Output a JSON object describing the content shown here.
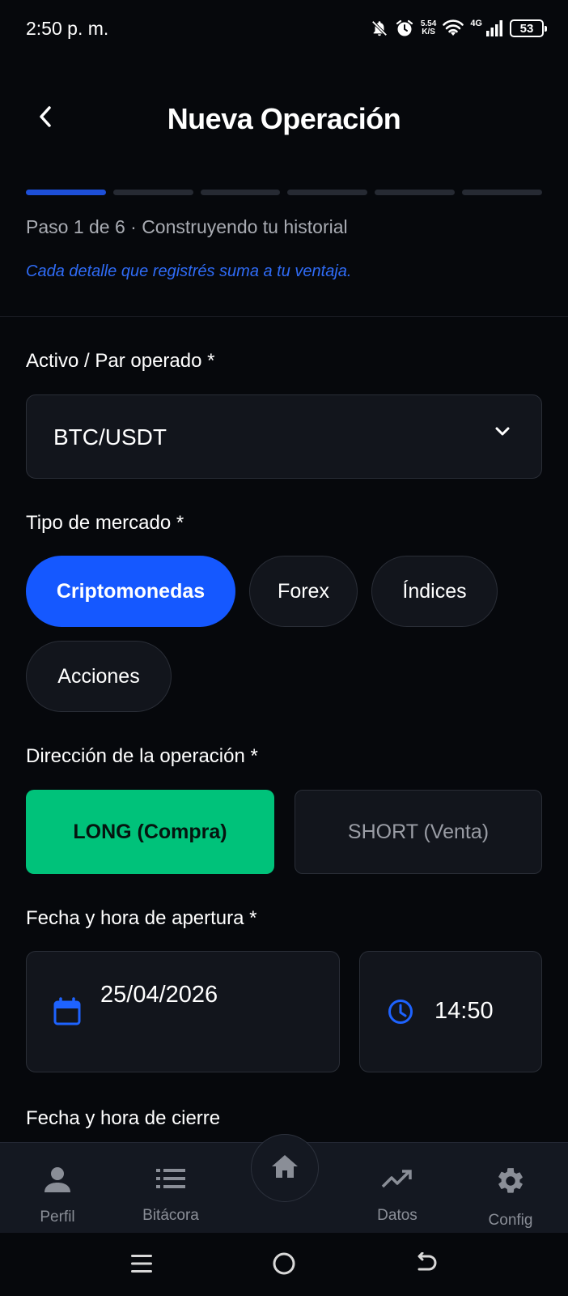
{
  "status_bar": {
    "time": "2:50 p. m.",
    "speed_value": "5.54",
    "speed_unit": "K/S",
    "network": "4G",
    "battery": "53"
  },
  "header": {
    "title": "Nueva Operación"
  },
  "progress": {
    "current_step": 1,
    "total_steps": 6,
    "step_text": "Paso 1 de 6 · Construyendo tu historial",
    "motivation": "Cada detalle que registrés suma a tu ventaja."
  },
  "form": {
    "asset": {
      "label": "Activo / Par operado *",
      "value": "BTC/USDT"
    },
    "market_type": {
      "label": "Tipo de mercado *",
      "options": [
        "Criptomonedas",
        "Forex",
        "Índices",
        "Acciones"
      ],
      "selected": "Criptomonedas"
    },
    "direction": {
      "label": "Dirección de la operación *",
      "long_label": "LONG (Compra)",
      "short_label": "SHORT (Venta)",
      "selected": "LONG (Compra)"
    },
    "open_datetime": {
      "label": "Fecha y hora de apertura *",
      "date": "25/04/2026",
      "time": "14:50"
    },
    "close_datetime": {
      "label": "Fecha y hora de cierre"
    }
  },
  "bottom_nav": {
    "items": [
      {
        "label": "Perfil",
        "icon": "person-icon"
      },
      {
        "label": "Bitácora",
        "icon": "list-icon"
      },
      {
        "label": "",
        "icon": "home-icon"
      },
      {
        "label": "Datos",
        "icon": "trending-up-icon"
      },
      {
        "label": "Config",
        "icon": "gear-icon"
      }
    ]
  },
  "colors": {
    "background": "#06080c",
    "accent_blue": "#1558ff",
    "long_green": "#00c27a",
    "card": "#12151c",
    "progress_active": "#1d4fd8"
  }
}
